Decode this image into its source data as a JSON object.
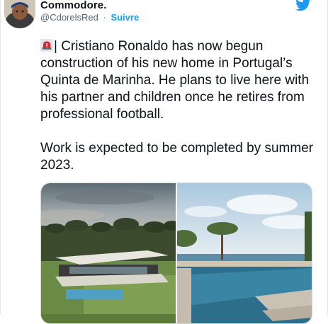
{
  "tweet": {
    "author_name": "Commodore.",
    "handle": "@CdorelsRed",
    "separator": "·",
    "follow_label": "Suivre",
    "text_after_icon": "| Cristiano Ronaldo has now begun construction of his new home in Portugal’s Quinta de Marinha. He plans to live here with his partner and children once he retires from professional football.\n\nWork is expected to be completed by summer 2023."
  },
  "icons": {
    "brand": "twitter-bird-icon",
    "alert": "rotating-light-siren-icon"
  },
  "colors": {
    "accent": "#1d9bf0",
    "text": "#0f1419",
    "muted": "#536471"
  }
}
